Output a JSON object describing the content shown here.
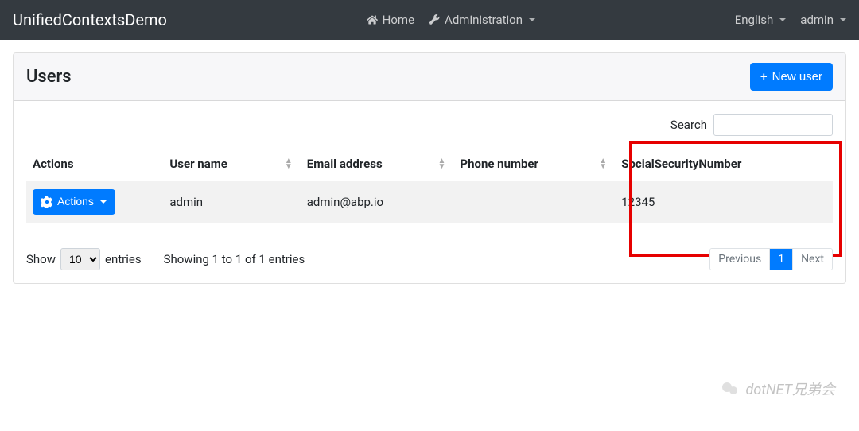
{
  "navbar": {
    "brand": "UnifiedContextsDemo",
    "home": "Home",
    "administration": "Administration",
    "language": "English",
    "user": "admin"
  },
  "page": {
    "title": "Users",
    "newUserBtn": "New user",
    "searchLabel": "Search",
    "searchValue": ""
  },
  "table": {
    "headers": {
      "actions": "Actions",
      "userName": "User name",
      "email": "Email address",
      "phone": "Phone number",
      "ssn": "SocialSecurityNumber"
    },
    "rows": [
      {
        "actionsLabel": "Actions",
        "userName": "admin",
        "email": "admin@abp.io",
        "phone": "",
        "ssn": "12345"
      }
    ]
  },
  "footer": {
    "showLabel": "Show",
    "entriesLabel": "entries",
    "lengthValue": "10",
    "info": "Showing 1 to 1 of 1 entries",
    "prev": "Previous",
    "page1": "1",
    "next": "Next"
  },
  "watermark": "dotNET兄弟会"
}
